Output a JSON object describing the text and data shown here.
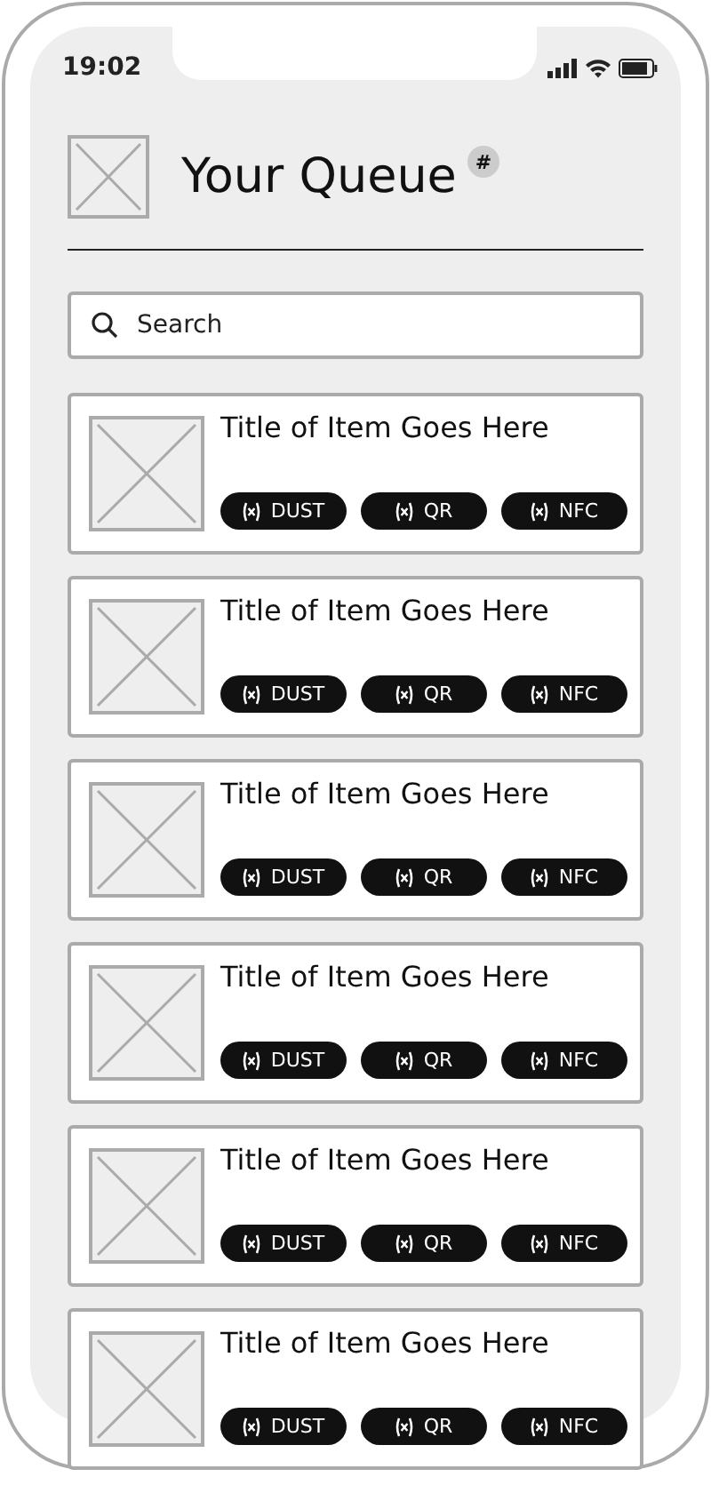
{
  "status_bar": {
    "time": "19:02"
  },
  "header": {
    "title": "Your Queue",
    "badge": "#"
  },
  "search": {
    "placeholder": "Search"
  },
  "items": [
    {
      "title": "Title of Item Goes Here",
      "tags": [
        "DUST",
        "QR",
        "NFC"
      ]
    },
    {
      "title": "Title of Item Goes Here",
      "tags": [
        "DUST",
        "QR",
        "NFC"
      ]
    },
    {
      "title": "Title of Item Goes Here",
      "tags": [
        "DUST",
        "QR",
        "NFC"
      ]
    },
    {
      "title": "Title of Item Goes Here",
      "tags": [
        "DUST",
        "QR",
        "NFC"
      ]
    },
    {
      "title": "Title of Item Goes Here",
      "tags": [
        "DUST",
        "QR",
        "NFC"
      ]
    },
    {
      "title": "Title of Item Goes Here",
      "tags": [
        "DUST",
        "QR",
        "NFC"
      ]
    }
  ]
}
